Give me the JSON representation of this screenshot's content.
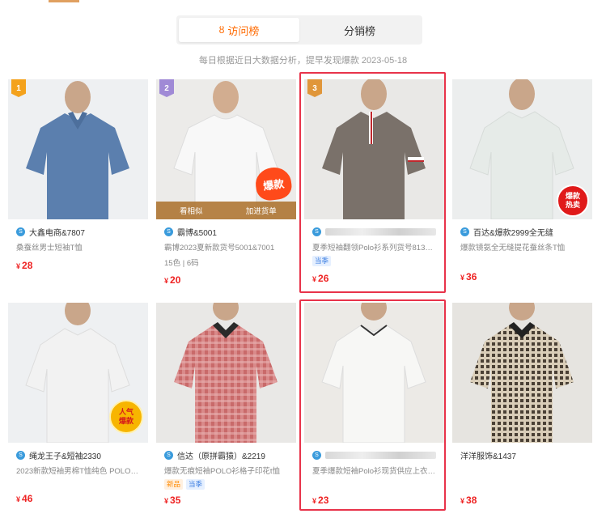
{
  "tabs": [
    {
      "label": "访问榜",
      "icon": "ranking-icon",
      "active": true
    },
    {
      "label": "分销榜",
      "active": false
    }
  ],
  "subtitle": "每日根据近日大数据分析，提早发现爆款 2023-05-18",
  "colors": {
    "accent": "#ff6a00",
    "price": "#ee2222",
    "highlight": "#e8334a"
  },
  "products": [
    {
      "rank": "1",
      "shop": "大鑫电商&7807",
      "title": "桑蚕丝男士短袖T恤",
      "price": "28",
      "shirt_color": "#5b7fae",
      "skin": "#c9a68a"
    },
    {
      "rank": "2",
      "shop": "霸博&5001",
      "title": "霸博2023夏新款货号5001&7001",
      "meta": "15色 | 6码",
      "price": "20",
      "shirt_color": "#f4f4f4",
      "overlay": [
        "看相似",
        "加进货单"
      ],
      "badge": "爆款"
    },
    {
      "rank": "3",
      "shop": "",
      "title": "夏季短袖翻领Polo衫系列货号813款...",
      "tags": [
        "当季"
      ],
      "price": "26",
      "shirt_color": "#7a716a"
    },
    {
      "shop": "百达&爆款2999全无缝",
      "title": "爆款镜氨全无缝提花蚕丝条T恤",
      "price": "36",
      "shirt_color": "#e6ebe8",
      "badge": "爆款\n热卖"
    },
    {
      "shop": "绳龙王子&短袖2330",
      "title": "2023新款短袖男棉T恤纯色 POLO衫 ...",
      "price": "46",
      "shirt_color": "#f2f2f2",
      "badge": "人气\n爆款"
    },
    {
      "shop": "信达（原拼霸猿）&2219",
      "title": "爆款无痕短袖POLO衫格子印花t恤",
      "tags": [
        "新品",
        "当季"
      ],
      "price": "35",
      "shirt_color": "#c96a6a"
    },
    {
      "shop": "",
      "title": "夏季爆款短袖Polo衫现货供应上衣厂...",
      "price": "23",
      "shirt_color": "#f7f7f5"
    },
    {
      "shop": "洋洋服饰&1437",
      "title": "",
      "price": "38",
      "shirt_color": "#5e5345"
    }
  ]
}
